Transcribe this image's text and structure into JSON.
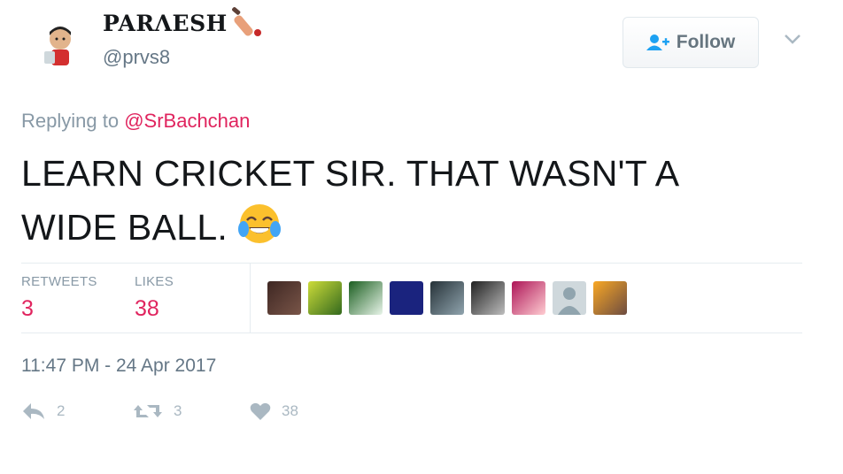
{
  "author": {
    "display_name": "PARΛESH",
    "handle": "@prvs8"
  },
  "follow": {
    "label": "Follow"
  },
  "reply": {
    "prefix": "Replying to",
    "mention": "@SrBachchan"
  },
  "tweet": {
    "text_line1": "LEARN CRICKET SIR. THAT WASN'T A",
    "text_line2": "WIDE BALL."
  },
  "stats": {
    "retweets_label": "RETWEETS",
    "retweets_value": "3",
    "likes_label": "LIKES",
    "likes_value": "38"
  },
  "timestamp": "11:47 PM - 24 Apr 2017",
  "actions": {
    "reply_count": "2",
    "retweet_count": "3",
    "like_count": "38"
  },
  "colors": {
    "accent_pink": "#e0245e",
    "muted": "#8899a6",
    "text": "#14171a"
  }
}
